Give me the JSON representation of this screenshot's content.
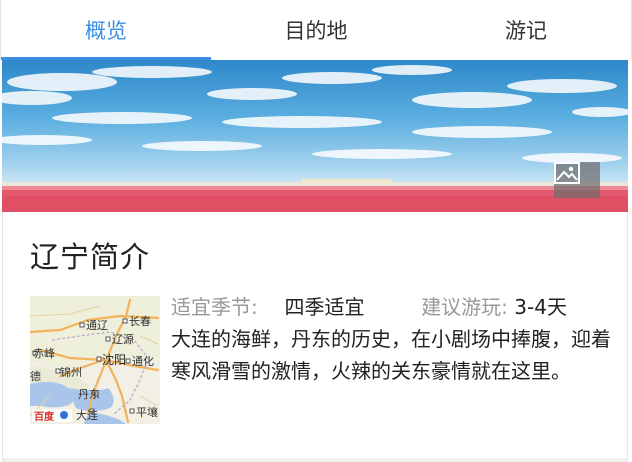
{
  "tabs": [
    {
      "label": "概览",
      "active": true
    },
    {
      "label": "目的地",
      "active": false
    },
    {
      "label": "游记",
      "active": false
    }
  ],
  "banner": {
    "icon": "image-gallery-icon"
  },
  "intro": {
    "title": "辽宁简介",
    "season_key": "适宜季节:",
    "season_value": "四季适宜",
    "play_key": "建议游玩:",
    "play_value": "3-4天",
    "description": "大连的海鲜，丹东的历史，在小剧场中捧腹，迎着寒风滑雪的激情，火辣的关东豪情就在这里。"
  },
  "map": {
    "labels": {
      "changchun": "长春",
      "tonghua_top": "通辽",
      "liaoyuan": "辽源",
      "chifeng": "赤峰",
      "shenyang": "沈阳",
      "tonghua": "通化",
      "jinzhou": "锦州",
      "dandong": "丹东",
      "dalian": "大连",
      "pyongyang": "平壤",
      "chengde": "德"
    },
    "logo_text": "百度"
  },
  "colors": {
    "accent": "#3a8ee6",
    "key_text": "#999999",
    "body_text": "#222222"
  }
}
